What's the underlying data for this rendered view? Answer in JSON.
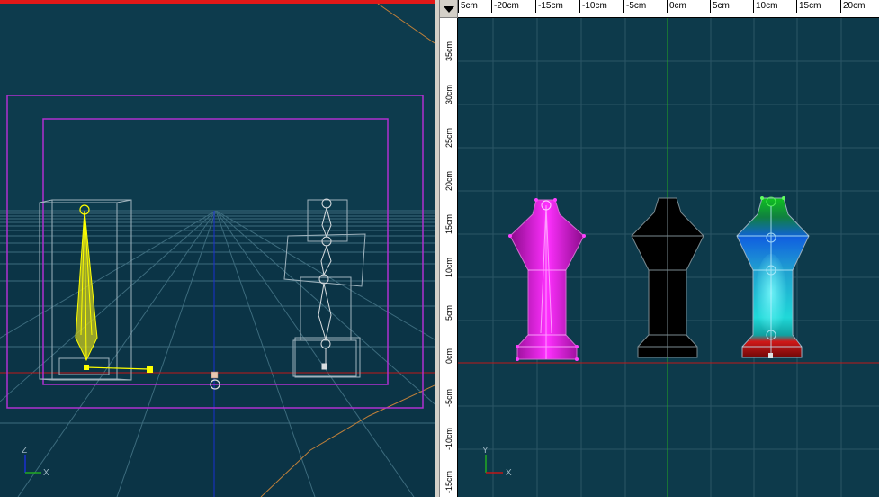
{
  "left_viewport": {
    "axis_labels": {
      "z": "Z",
      "x": "X"
    }
  },
  "right_viewport": {
    "h_ruler_labels": [
      "5cm",
      "-20cm",
      "-15cm",
      "-10cm",
      "-5cm",
      "0cm",
      "5cm",
      "10cm",
      "15cm",
      "20cm"
    ],
    "v_ruler_labels": [
      "35cm",
      "30cm",
      "25cm",
      "20cm",
      "15cm",
      "10cm",
      "5cm",
      "0cm",
      "-5cm",
      "-10cm",
      "-15cm"
    ],
    "axis_labels": {
      "y": "Y",
      "x": "X"
    }
  },
  "colors": {
    "viewport_bg": "#0b3446",
    "grid": "#2a5566",
    "selection_yellow": "#ffff00",
    "camera_frame": "#b030d0",
    "x_axis": "#c01818",
    "y_axis": "#22aa22",
    "z_axis": "#1a2fd0"
  }
}
